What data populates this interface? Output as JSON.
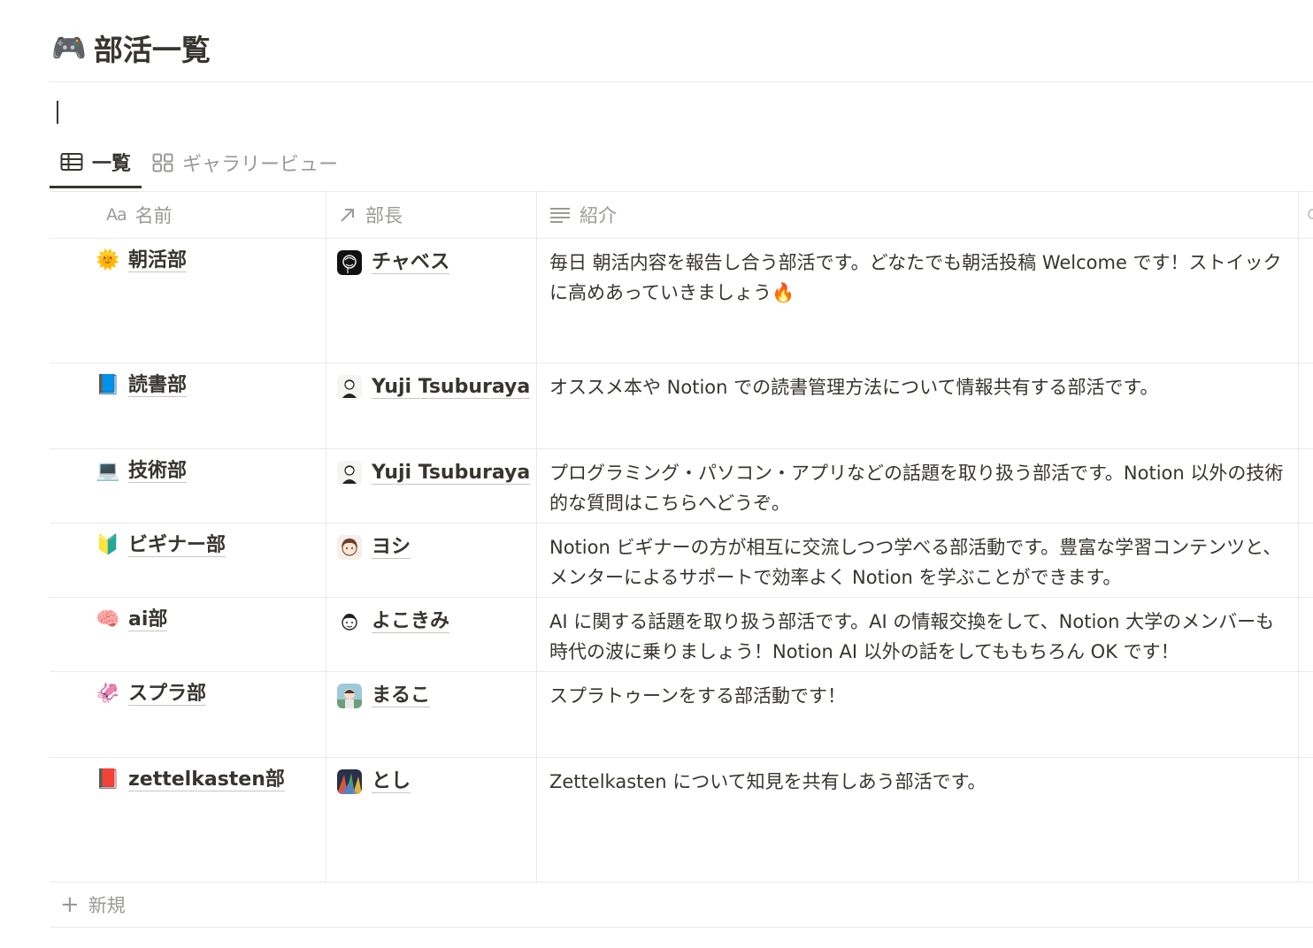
{
  "page": {
    "title": "部活一覧",
    "title_icon": "🎮"
  },
  "tabs": [
    {
      "label": "一覧",
      "icon": "table-icon",
      "active": true
    },
    {
      "label": "ギャラリービュー",
      "icon": "gallery-icon",
      "active": false
    }
  ],
  "table": {
    "columns": [
      {
        "label": "名前",
        "icon_text": "Aa",
        "icon": "text-property-icon"
      },
      {
        "label": "部長",
        "icon": "relation-arrow-icon"
      },
      {
        "label": "紹介",
        "icon": "lines-icon"
      }
    ],
    "rows": [
      {
        "emoji": "🌞",
        "name": "朝活部",
        "leader": "チャベス",
        "avatar": "avatar-chavez",
        "intro": "毎日 朝活内容を報告し合う部活です。どなたでも朝活投稿 Welcome です！ストイックに高めあっていきましょう🔥"
      },
      {
        "emoji": "📘",
        "name": "読書部",
        "leader": "Yuji Tsuburaya",
        "avatar": "avatar-yuji",
        "intro": "オススメ本や Notion での読書管理方法について情報共有する部活です。"
      },
      {
        "emoji": "💻",
        "name": "技術部",
        "leader": "Yuji Tsuburaya",
        "avatar": "avatar-yuji",
        "intro": "プログラミング・パソコン・アプリなどの話題を取り扱う部活です。Notion 以外の技術的な質問はこちらへどうぞ。"
      },
      {
        "emoji": "🔰",
        "name": "ビギナー部",
        "leader": "ヨシ",
        "avatar": "avatar-yoshi",
        "intro": "Notion ビギナーの方が相互に交流しつつ学べる部活動です。豊富な学習コンテンツと、メンターによるサポートで効率よく Notion を学ぶことができます。"
      },
      {
        "emoji": "🧠",
        "name": "ai部",
        "leader": "よこきみ",
        "avatar": "avatar-yokokimi",
        "intro": "AI に関する話題を取り扱う部活です。AI の情報交換をして、Notion 大学のメンバーも時代の波に乗りましょう！Notion AI 以外の話をしてももちろん OK です！"
      },
      {
        "emoji": "🦑",
        "name": "スプラ部",
        "leader": "まるこ",
        "avatar": "avatar-maruko",
        "intro": "スプラトゥーンをする部活動です！"
      },
      {
        "emoji": "📕",
        "name": "zettelkasten部",
        "leader": "とし",
        "avatar": "avatar-toshi",
        "intro": "Zettelkasten について知見を共有しあう部活です。"
      }
    ],
    "new_label": "新規"
  }
}
